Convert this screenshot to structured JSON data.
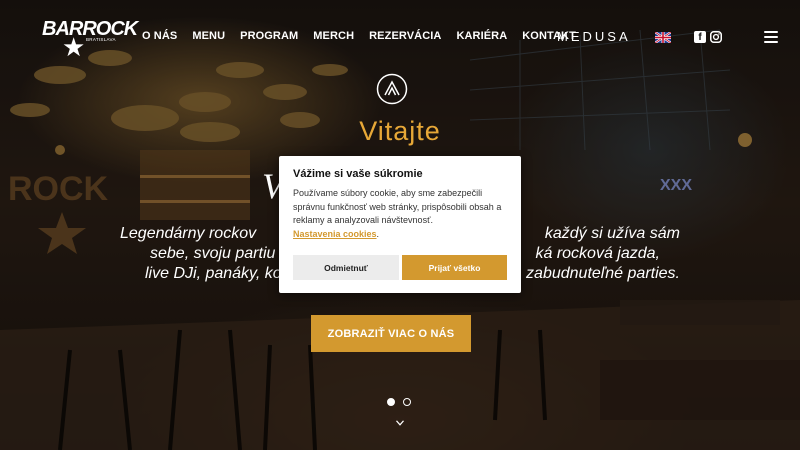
{
  "header": {
    "logo_text": "BARROCK",
    "logo_subtext": "BRATISLAVA",
    "nav": [
      "O NÁS",
      "MENU",
      "PROGRAM",
      "MERCH",
      "REZERVÁCIA",
      "KARIÉRA",
      "KONTAKT"
    ],
    "partner_logo": "MEDUSA",
    "language_flag": "uk-flag-icon",
    "social_icons": [
      "facebook-icon",
      "instagram-icon"
    ],
    "menu_icon": "hamburger-menu-icon"
  },
  "hero": {
    "welcome": "Vitajte",
    "partial_heading": "V",
    "paragraph_line1": "Legendárny rockov",
    "paragraph_line1_end": "každý si užíva sám",
    "paragraph_line2": "sebe, svoju partiu a",
    "paragraph_line2_end": "ká rocková jazda,",
    "paragraph_line3": "live DJi, panáky, ko",
    "paragraph_line3_end": "zabudnuteľné parties.",
    "cta": "ZOBRAZIŤ VIAC O NÁS",
    "slider_dots": 2,
    "active_dot": 0,
    "scroll_icon": "chevron-down-icon"
  },
  "cookie": {
    "title": "Vážime si vaše súkromie",
    "text": "Používame súbory cookie, aby sme zabezpečili správnu funkčnosť web stránky, prispôsobili obsah a reklamy a analyzovali návštevnosť.",
    "settings_link": "Nastavenia cookies",
    "settings_suffix": ".",
    "decline": "Odmietnuť",
    "accept": "Prijať všetko"
  },
  "colors": {
    "accent": "#d3992f",
    "welcome": "#e7a837"
  }
}
